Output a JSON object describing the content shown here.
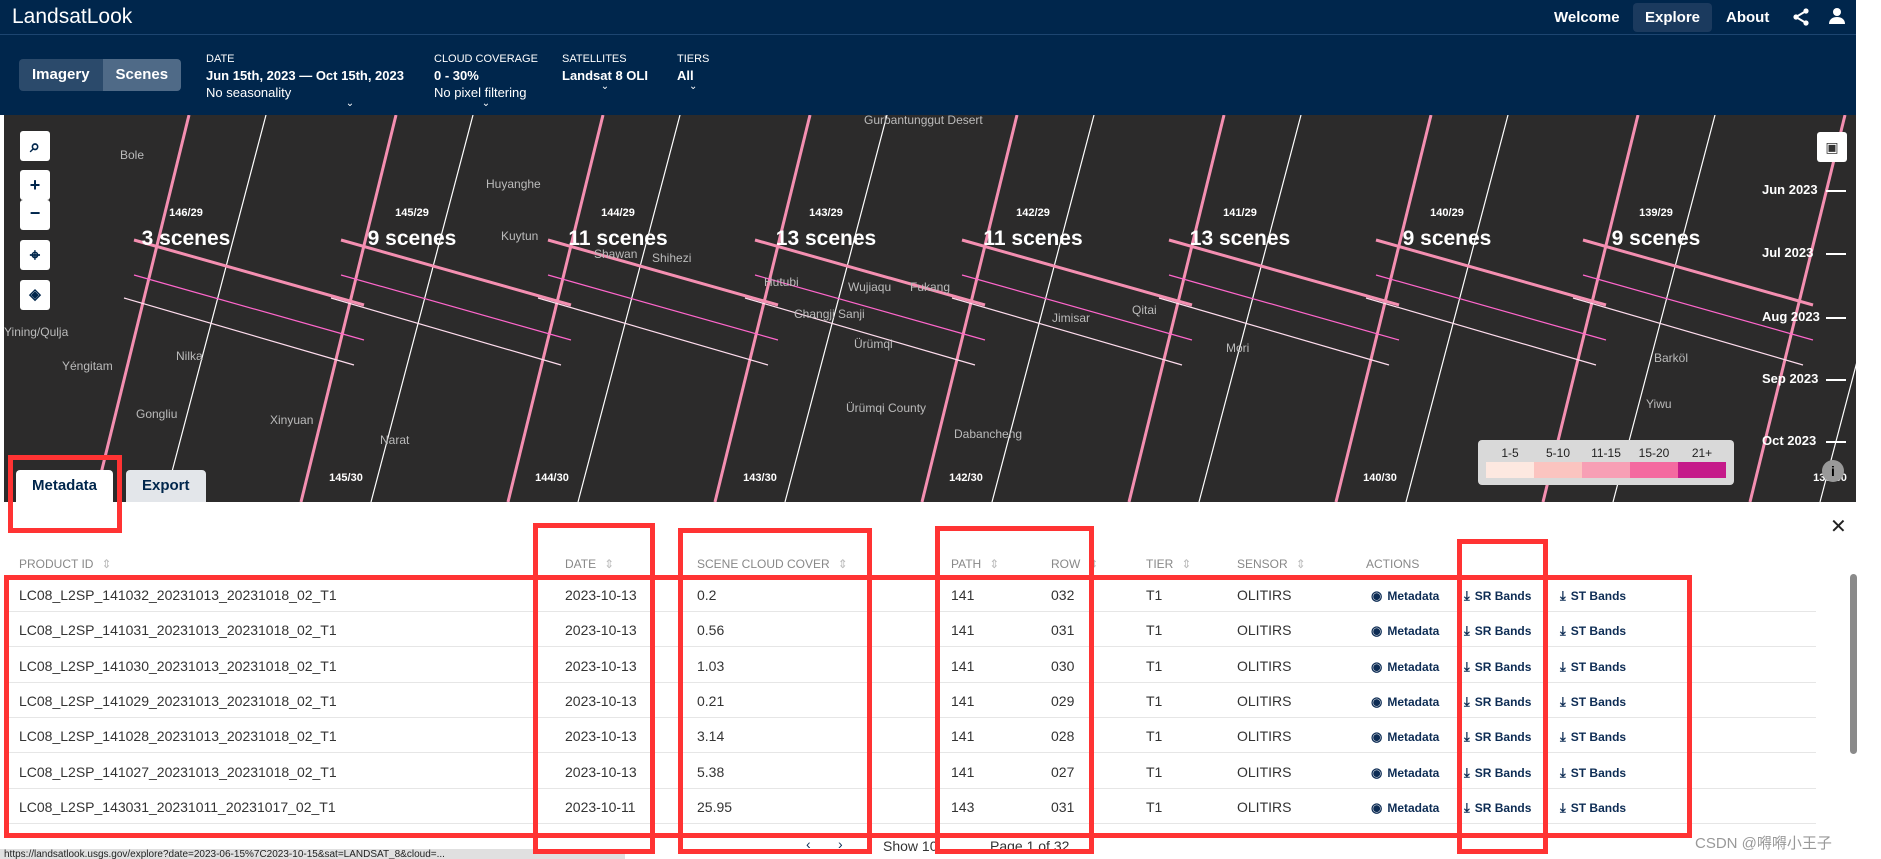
{
  "app": {
    "title": "LandsatLook"
  },
  "nav": [
    {
      "label": "Welcome"
    },
    {
      "label": "Explore",
      "active": true
    },
    {
      "label": "About"
    }
  ],
  "nav_icons": [
    "share-icon",
    "user-icon"
  ],
  "mode": {
    "imagery": "Imagery",
    "scenes": "Scenes",
    "active": "Scenes"
  },
  "filters": {
    "date": {
      "label": "DATE",
      "value": "Jun 15th, 2023 — Oct 15th, 2023",
      "sub": "No seasonality"
    },
    "cloud": {
      "label": "CLOUD COVERAGE",
      "value": "0 - 30%",
      "sub": "No pixel filtering"
    },
    "satellites": {
      "label": "SATELLITES",
      "value": "Landsat 8 OLI"
    },
    "tiers": {
      "label": "TIERS",
      "value": "All"
    }
  },
  "map": {
    "paths_top": [
      {
        "id": "146/29",
        "count": "3 scenes"
      },
      {
        "id": "145/29",
        "count": "9 scenes"
      },
      {
        "id": "144/29",
        "count": "11 scenes"
      },
      {
        "id": "143/29",
        "count": "13 scenes"
      },
      {
        "id": "142/29",
        "count": "11 scenes"
      },
      {
        "id": "141/29",
        "count": "13 scenes"
      },
      {
        "id": "140/29",
        "count": "9 scenes"
      },
      {
        "id": "139/29",
        "count": "9 scenes"
      }
    ],
    "paths_bottom": [
      "145/30",
      "144/30",
      "143/30",
      "142/30",
      "140/30",
      "139/30",
      "138/30"
    ],
    "cities": [
      "Gurbantunggut Desert",
      "Bole",
      "Huyanghe",
      "Kuytun",
      "Shawan",
      "Shihezi",
      "Hutubi",
      "Wujiaqu",
      "Fukang",
      "Changji Sanji",
      "Ürümqi",
      "Jimisar",
      "Qitai",
      "Mori",
      "Barköl",
      "Yiwu",
      "Yining/Qulja",
      "Yéngitam",
      "Nilka",
      "Gongliu",
      "Xinyuan",
      "Narat",
      "Ürümqi County",
      "Dabancheng"
    ],
    "timeline": [
      "Jun 2023",
      "Jul 2023",
      "Aug 2023",
      "Sep 2023",
      "Oct 2023"
    ],
    "legend": {
      "labels": [
        "1-5",
        "5-10",
        "11-15",
        "15-20",
        "21+"
      ],
      "colors": [
        "#fde8e0",
        "#fbc4c0",
        "#f79fb5",
        "#f46aa0",
        "#c51b8a"
      ]
    },
    "footprint_color": "#f48fb1"
  },
  "tabs": [
    {
      "label": "Metadata",
      "active": true
    },
    {
      "label": "Export"
    }
  ],
  "table": {
    "headers": [
      "PRODUCT ID",
      "DATE",
      "SCENE CLOUD COVER",
      "PATH",
      "ROW",
      "TIER",
      "SENSOR",
      "ACTIONS"
    ],
    "actions": [
      "Metadata",
      "SR Bands",
      "ST Bands"
    ],
    "rows": [
      [
        "LC08_L2SP_141032_20231013_20231018_02_T1",
        "2023-10-13",
        "0.2",
        "141",
        "032",
        "T1",
        "OLITIRS"
      ],
      [
        "LC08_L2SP_141031_20231013_20231018_02_T1",
        "2023-10-13",
        "0.56",
        "141",
        "031",
        "T1",
        "OLITIRS"
      ],
      [
        "LC08_L2SP_141030_20231013_20231018_02_T1",
        "2023-10-13",
        "1.03",
        "141",
        "030",
        "T1",
        "OLITIRS"
      ],
      [
        "LC08_L2SP_141029_20231013_20231018_02_T1",
        "2023-10-13",
        "0.21",
        "141",
        "029",
        "T1",
        "OLITIRS"
      ],
      [
        "LC08_L2SP_141028_20231013_20231018_02_T1",
        "2023-10-13",
        "3.14",
        "141",
        "028",
        "T1",
        "OLITIRS"
      ],
      [
        "LC08_L2SP_141027_20231013_20231018_02_T1",
        "2023-10-13",
        "5.38",
        "141",
        "027",
        "T1",
        "OLITIRS"
      ],
      [
        "LC08_L2SP_143031_20231011_20231017_02_T1",
        "2023-10-11",
        "25.95",
        "143",
        "031",
        "T1",
        "OLITIRS"
      ]
    ]
  },
  "pagination": {
    "show": "Show 10",
    "page": "Page 1 of 32"
  },
  "status_url": "https://landsatlook.usgs.gov/explore?date=2023-06-15%7C2023-10-15&sat=LANDSAT_8&cloud=...",
  "watermark": "CSDN @嘚嘚小王子"
}
